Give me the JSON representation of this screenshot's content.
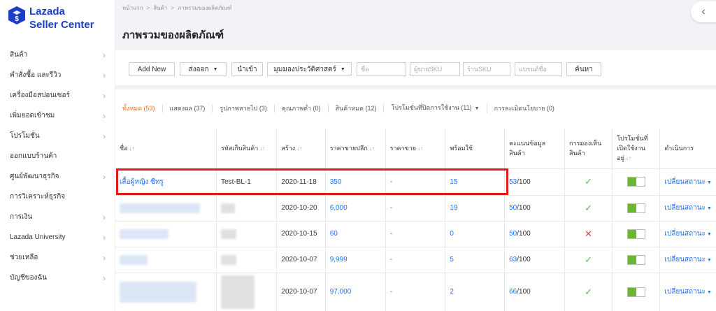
{
  "logo": {
    "line1": "Lazada",
    "line2": "Seller Center"
  },
  "sidebar": {
    "items": [
      {
        "label": "สินค้า",
        "chevron": true
      },
      {
        "label": "คำสั่งซื้อ และรีวิว",
        "chevron": true
      },
      {
        "label": "เครื่องมือสปอนเซอร์",
        "chevron": true
      },
      {
        "label": "เพิ่มยอดเข้าชม",
        "chevron": true
      },
      {
        "label": "โปรโมชั่น",
        "chevron": true
      },
      {
        "label": "ออกแบบร้านค้า",
        "chevron": false
      },
      {
        "label": "ศูนย์พัฒนาธุรกิจ",
        "chevron": true
      },
      {
        "label": "การวิเคราะห์ธุรกิจ",
        "chevron": false
      },
      {
        "label": "การเงิน",
        "chevron": true
      },
      {
        "label": "Lazada University",
        "chevron": true
      },
      {
        "label": "ช่วยเหลือ",
        "chevron": true
      },
      {
        "label": "บัญชีของฉัน",
        "chevron": true
      }
    ]
  },
  "breadcrumb": [
    "หน้าแรก",
    "สินค้า",
    "ภาพรวมของผลิตภัณฑ์"
  ],
  "page_title": "ภาพรวมของผลิตภัณฑ์",
  "filters": {
    "add_new": "Add New",
    "export": "ส่งออก",
    "import": "นำเข้า",
    "history_view": "มุมมองประวัติศาสตร์",
    "name_placeholder": "ชื่อ",
    "seller_sku_placeholder": "ผู้ขายSKU",
    "shop_sku_placeholder": "ร้านSKU",
    "brand_placeholder": "แบรนด์ชื่อ",
    "search": "ค้นหา"
  },
  "tabs": [
    {
      "label": "ทั้งหมด (53)",
      "active": true,
      "caret": false
    },
    {
      "label": "แสดงผล (37)",
      "active": false,
      "caret": false
    },
    {
      "label": "รูปภาพหายไป (3)",
      "active": false,
      "caret": false
    },
    {
      "label": "คุณภาพต่ำ (0)",
      "active": false,
      "caret": false
    },
    {
      "label": "สินค้าหมด (12)",
      "active": false,
      "caret": false
    },
    {
      "label": "โปรโมชั่นที่ปิดการใช้งาน (11)",
      "active": false,
      "caret": true
    },
    {
      "label": "การละเมิดนโยบาย (0)",
      "active": false,
      "caret": false
    }
  ],
  "table": {
    "headers": {
      "name": "ชื่อ",
      "sku": "รหัสเก็บสินค้า",
      "created": "สร้าง",
      "retail_price": "ราคาขายปลีก",
      "sale_price": "ราคาขาย",
      "available": "พร้อมใช้",
      "content_score": "คะแนนข้อมูลสินค้า",
      "visibility": "การมองเห็นสินค้า",
      "promo_active": "โปรโมชั่นที่เปิดใช้งานอยู่",
      "actions": "ดำเนินการ"
    },
    "score_suffix": "/100",
    "action_label": "เปลี่ยนสถานะ",
    "rows": [
      {
        "name": "เสื้อผู้หญิง ซีทรู",
        "sku": "Test-BL-1",
        "created": "2020-11-18",
        "retail_price": "350",
        "sale_price": "-",
        "available": "15",
        "score": "53",
        "visible": true,
        "promo_on": true
      },
      {
        "name": "",
        "sku": "",
        "created": "2020-10-20",
        "retail_price": "6,000",
        "sale_price": "-",
        "available": "19",
        "score": "50",
        "visible": true,
        "promo_on": true
      },
      {
        "name": "",
        "sku": "",
        "created": "2020-10-15",
        "retail_price": "60",
        "sale_price": "-",
        "available": "0",
        "score": "50",
        "visible": false,
        "promo_on": true
      },
      {
        "name": "",
        "sku": "",
        "created": "2020-10-07",
        "retail_price": "9,999",
        "sale_price": "-",
        "available": "5",
        "score": "63",
        "visible": true,
        "promo_on": true
      },
      {
        "name": "",
        "sku": "",
        "created": "2020-10-07",
        "retail_price": "97,000",
        "sale_price": "-",
        "available": "2",
        "score": "66",
        "visible": true,
        "promo_on": true
      }
    ]
  },
  "colors": {
    "brand": "#1a3fc6",
    "accent": "#f57224",
    "link": "#1a71ff",
    "toggle_on": "#6bb633",
    "highlight": "#e21a1a"
  }
}
